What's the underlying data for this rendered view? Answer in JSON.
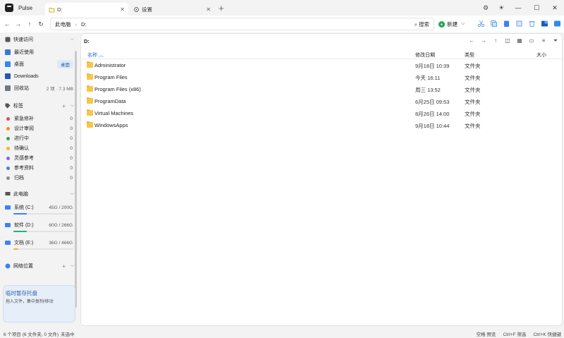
{
  "app": {
    "name": "Pulse"
  },
  "tabs": [
    {
      "label": "D:",
      "active": true
    },
    {
      "label": "设置",
      "active": false
    }
  ],
  "address": {
    "crumbs": [
      "此电脑",
      "D:"
    ],
    "search_label": "搜索",
    "new_label": "新建"
  },
  "sidebar": {
    "quick_access": {
      "title": "快速访问",
      "items": [
        {
          "label": "最近使用",
          "right": ""
        },
        {
          "label": "桌面",
          "badge": "桌面"
        },
        {
          "label": "Downloads",
          "right": ""
        },
        {
          "label": "回收站",
          "right": "2 项 · 7.3 MB"
        }
      ]
    },
    "tags": {
      "title": "标签",
      "items": [
        {
          "label": "紧急修补",
          "count": "0",
          "color": "#e5484d"
        },
        {
          "label": "设计审阅",
          "count": "0",
          "color": "#f28c28"
        },
        {
          "label": "进行中",
          "count": "0",
          "color": "#2fa84f"
        },
        {
          "label": "待确认",
          "count": "0",
          "color": "#e8b92a"
        },
        {
          "label": "灵感参考",
          "count": "0",
          "color": "#8b5cf6"
        },
        {
          "label": "参考资料",
          "count": "0",
          "color": "#3b82f6"
        },
        {
          "label": "归档",
          "count": "0",
          "color": "#8a8a8a"
        }
      ]
    },
    "this_pc": {
      "title": "此电脑",
      "drives": [
        {
          "label": "系统 (C:)",
          "size": "45G / 200G",
          "used_fraction": 0.225,
          "color": "#3b82f6"
        },
        {
          "label": "软件 (D:)",
          "size": "60G / 266G",
          "used_fraction": 0.226,
          "color": "#22b07d"
        },
        {
          "label": "文档 (E:)",
          "size": "36G / 466G",
          "used_fraction": 0.077,
          "color": "#e8b92a"
        }
      ]
    },
    "network": {
      "title": "网络位置"
    },
    "tray": {
      "title": "临时暂存托盘",
      "subtitle": "拖入文件，集中复制/移动"
    }
  },
  "main": {
    "path": "D:",
    "columns": {
      "name": "名称",
      "date": "修改日期",
      "type": "类型",
      "size": "大小"
    },
    "rows": [
      {
        "name": "Administrator",
        "date": "9月18日 10:39",
        "type": "文件夹"
      },
      {
        "name": "Program Files",
        "date": "今天 16:11",
        "type": "文件夹"
      },
      {
        "name": "Program Files (x86)",
        "date": "周三 13:52",
        "type": "文件夹"
      },
      {
        "name": "ProgramData",
        "date": "6月25日 09:53",
        "type": "文件夹"
      },
      {
        "name": "Virtual Machines",
        "date": "8月26日 14:00",
        "type": "文件夹"
      },
      {
        "name": "WindowsApps",
        "date": "9月18日 10:44",
        "type": "文件夹"
      }
    ]
  },
  "status": {
    "left": "6 个项目 (6 文件夹, 0 文件)",
    "mid": "未选中",
    "hints": [
      "空格 预览",
      "Ctrl+F 筛选",
      "Ctrl+K 快捷键"
    ]
  }
}
